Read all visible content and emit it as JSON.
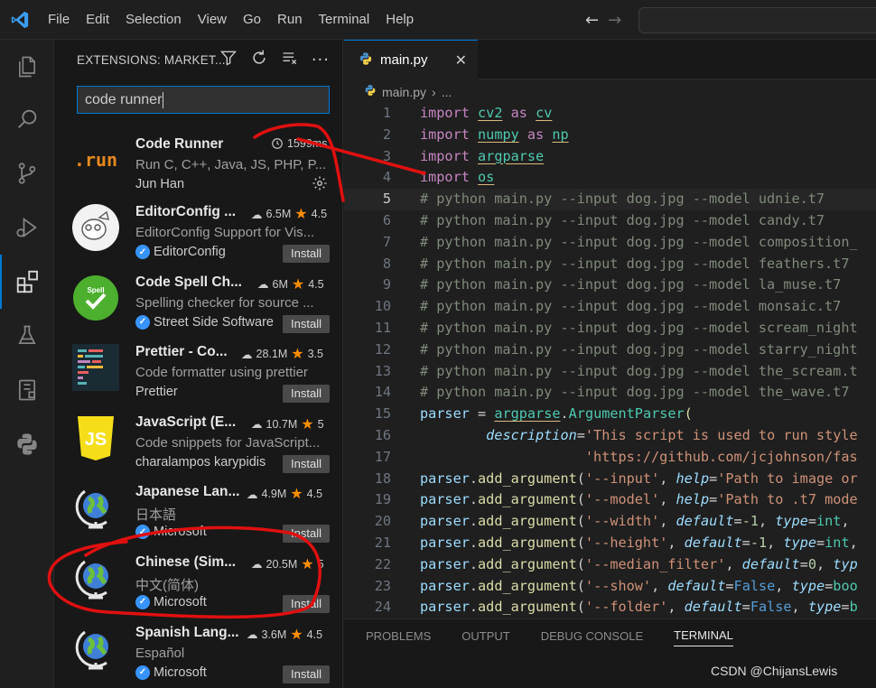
{
  "menu": [
    "File",
    "Edit",
    "Selection",
    "View",
    "Go",
    "Run",
    "Terminal",
    "Help"
  ],
  "activity_icons": [
    "explorer-icon",
    "search-icon",
    "source-control-icon",
    "run-debug-icon",
    "extensions-icon",
    "testing-icon",
    "remote-explorer-icon",
    "python-icon"
  ],
  "sidebar": {
    "title": "EXTENSIONS: MARKET...",
    "search_value": "code runner"
  },
  "extensions": [
    {
      "name": "Code Runner",
      "desc": "Run C, C++, Java, JS, PHP, P...",
      "publisher": "Jun Han",
      "stat": "1599ms",
      "verified": false,
      "installed": true
    },
    {
      "name": "EditorConfig ...",
      "desc": "EditorConfig Support for Vis...",
      "publisher": "EditorConfig",
      "downloads": "6.5M",
      "rating": "4.5",
      "verified": true,
      "install": "Install"
    },
    {
      "name": "Code Spell Ch...",
      "desc": "Spelling checker for source ...",
      "publisher": "Street Side Software",
      "downloads": "6M",
      "rating": "4.5",
      "verified": true,
      "install": "Install"
    },
    {
      "name": "Prettier - Co...",
      "desc": "Code formatter using prettier",
      "publisher": "Prettier",
      "downloads": "28.1M",
      "rating": "3.5",
      "verified": false,
      "install": "Install"
    },
    {
      "name": "JavaScript (E...",
      "desc": "Code snippets for JavaScript...",
      "publisher": "charalampos karypidis",
      "downloads": "10.7M",
      "rating": "5",
      "verified": false,
      "install": "Install"
    },
    {
      "name": "Japanese Lan...",
      "desc": "日本語",
      "publisher": "Microsoft",
      "downloads": "4.9M",
      "rating": "4.5",
      "verified": true,
      "install": "Install"
    },
    {
      "name": "Chinese (Sim...",
      "desc": "中文(简体)",
      "publisher": "Microsoft",
      "downloads": "20.5M",
      "rating": "5",
      "verified": true,
      "install": "Install"
    },
    {
      "name": "Spanish Lang...",
      "desc": "Español",
      "publisher": "Microsoft",
      "downloads": "3.6M",
      "rating": "4.5",
      "verified": true,
      "install": "Install"
    }
  ],
  "editor": {
    "tab_label": "main.py",
    "breadcrumb_file": "main.py",
    "breadcrumb_more": "...",
    "current_line": 5,
    "line_numbers": [
      "1",
      "2",
      "3",
      "4",
      "5",
      "6",
      "7",
      "8",
      "9",
      "10",
      "11",
      "12",
      "13",
      "14",
      "15",
      "16",
      "17",
      "18",
      "19",
      "20",
      "21",
      "22",
      "23",
      "24"
    ]
  },
  "panel_tabs": [
    "PROBLEMS",
    "OUTPUT",
    "DEBUG CONSOLE",
    "TERMINAL"
  ],
  "watermark": "CSDN @ChijansLewis",
  "colors": {
    "accent": "#0078d4",
    "keyword": "#c586c0",
    "module": "#4ec9b0",
    "comment": "#6a9955",
    "string": "#ce9178",
    "star": "#ff8e00",
    "annotation": "#e01010"
  }
}
